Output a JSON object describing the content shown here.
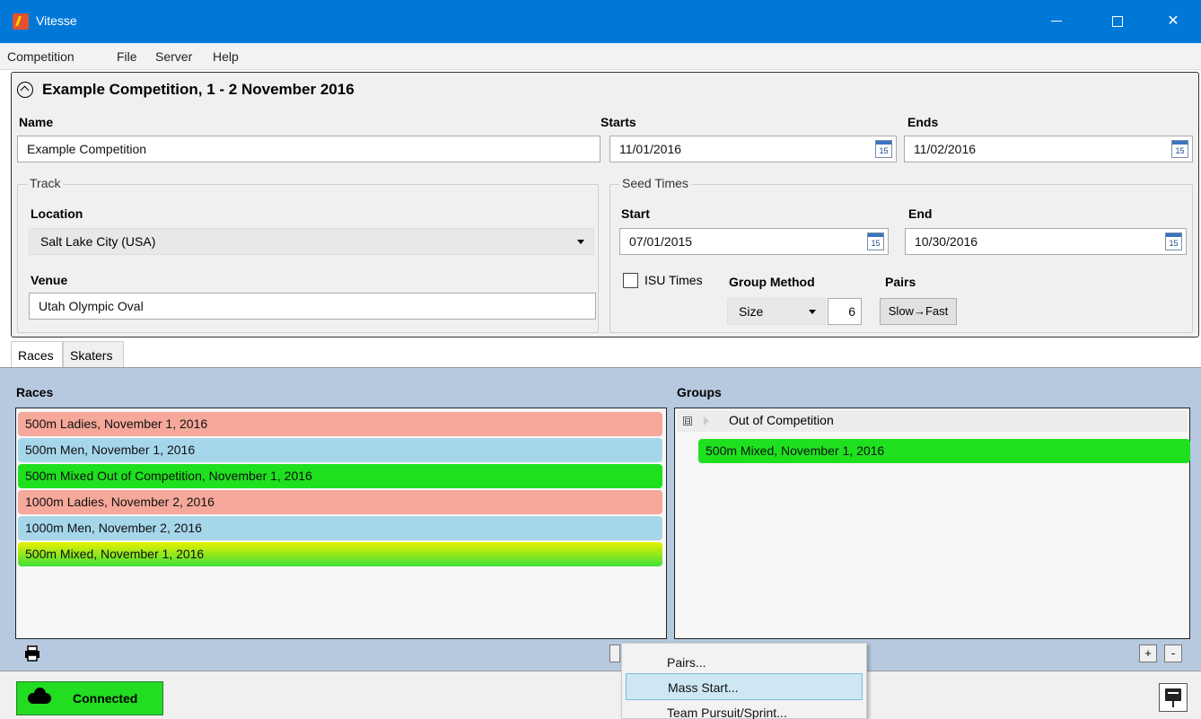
{
  "window": {
    "title": "Vitesse",
    "accent_color": "#0078d7"
  },
  "menu": [
    "Competition",
    "File",
    "Server",
    "Help"
  ],
  "competition": {
    "header": "Example Competition, 1 - 2 November 2016",
    "name_label": "Name",
    "name_value": "Example Competition",
    "starts_label": "Starts",
    "starts_value": "11/01/2016",
    "ends_label": "Ends",
    "ends_value": "11/02/2016",
    "calendar_day": "15"
  },
  "track": {
    "title": "Track",
    "location_label": "Location",
    "location_value": "Salt Lake City (USA)",
    "venue_label": "Venue",
    "venue_value": "Utah Olympic Oval"
  },
  "seed_times": {
    "title": "Seed Times",
    "start_label": "Start",
    "start_value": "07/01/2015",
    "end_label": "End",
    "end_value": "10/30/2016",
    "isu_label": "ISU Times",
    "isu_checked": false,
    "group_method_label": "Group Method",
    "group_method_value": "Size",
    "group_size": "6",
    "pairs_label": "Pairs",
    "pairs_button": "Slow→Fast"
  },
  "tabs": [
    {
      "label": "Races",
      "active": true
    },
    {
      "label": "Skaters",
      "active": false
    }
  ],
  "races": {
    "heading": "Races",
    "items": [
      {
        "label": "500m Ladies, November 1, 2016",
        "color": "#f6a89b"
      },
      {
        "label": "500m Men, November 1, 2016",
        "color": "#a6d6ea"
      },
      {
        "label": "500m Mixed Out of Competition, November 1, 2016",
        "color": "#1fe01f"
      },
      {
        "label": "1000m Ladies, November 2, 2016",
        "color": "#f6a89b"
      },
      {
        "label": "1000m Men, November 2, 2016",
        "color": "#a6d6ea"
      },
      {
        "label": "500m Mixed, November 1, 2016",
        "color": "#b5e61d"
      }
    ]
  },
  "groups": {
    "heading": "Groups",
    "group_name": "Out of Competition",
    "collapse_symbol": "⊟",
    "items": [
      {
        "label": "500m Mixed, November 1, 2016",
        "color": "#1fe01f"
      }
    ]
  },
  "toolbar": {
    "add": "+",
    "remove": "-"
  },
  "status": {
    "connection": "Connected",
    "connection_color": "#22dd22"
  },
  "context_menu": [
    "Pairs...",
    "Mass Start...",
    "Team Pursuit/Sprint..."
  ],
  "icons": [
    "app-icon",
    "minimize-icon",
    "maximize-icon",
    "close-icon",
    "collapse-icon",
    "calendar-icon",
    "dropdown-arrow-icon",
    "print-icon",
    "cloud-icon",
    "server-icon"
  ]
}
